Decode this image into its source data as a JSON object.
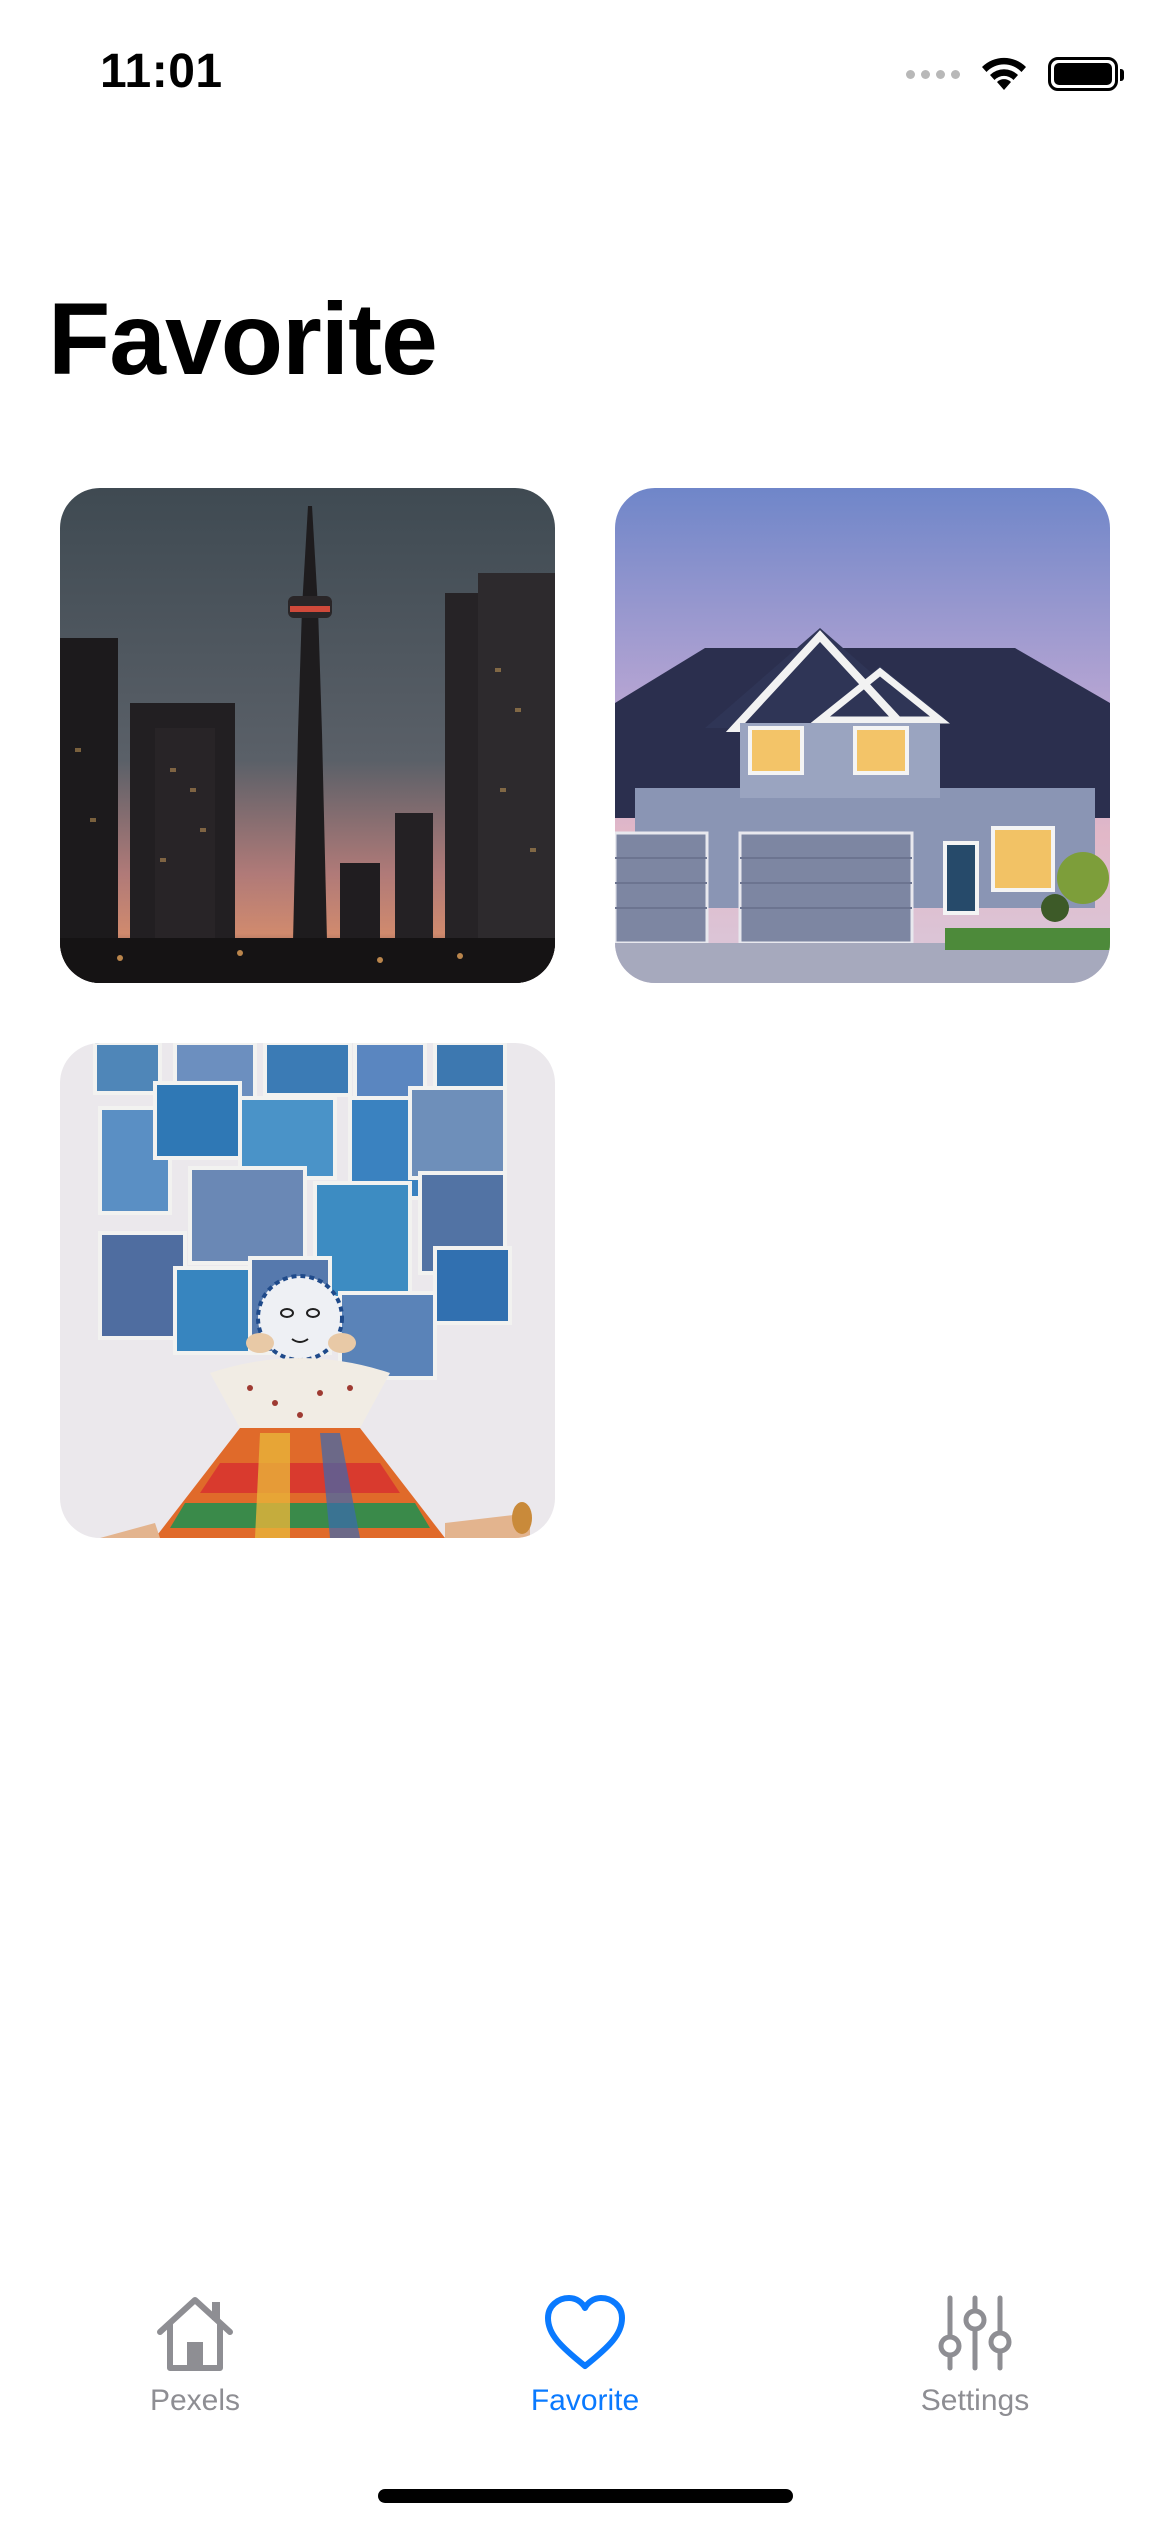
{
  "status_bar": {
    "time": "11:01",
    "icons": [
      "signal-dots-icon",
      "wifi-icon",
      "battery-icon"
    ]
  },
  "page": {
    "title": "Favorite"
  },
  "photos": [
    {
      "subject": "city-skyline-tower-photo"
    },
    {
      "subject": "suburban-house-photo"
    },
    {
      "subject": "blue-patchwork-art-photo"
    }
  ],
  "tab_bar": {
    "tabs": [
      {
        "label": "Pexels",
        "icon": "house-icon",
        "active": false
      },
      {
        "label": "Favorite",
        "icon": "heart-icon",
        "active": true
      },
      {
        "label": "Settings",
        "icon": "sliders-icon",
        "active": false
      }
    ],
    "active_color": "#0a7aff",
    "inactive_color": "#8e8e93"
  }
}
